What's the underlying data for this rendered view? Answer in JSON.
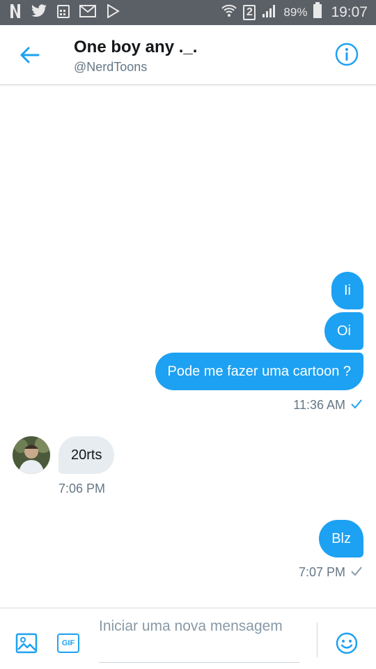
{
  "status_bar": {
    "icons": [
      "netflix-icon",
      "twitter-icon",
      "calendar-icon",
      "mail-icon",
      "play-store-icon",
      "wifi-icon",
      "sim-icon",
      "signal-icon",
      "battery-icon"
    ],
    "sim_label": "2",
    "battery": "89%",
    "time": "19:07"
  },
  "header": {
    "title": "One boy any ._.",
    "handle": "@NerdToons"
  },
  "colors": {
    "accent": "#1da1f2",
    "incoming": "#e6ecf0"
  },
  "messages": [
    {
      "direction": "out",
      "text": "Ii"
    },
    {
      "direction": "out",
      "text": "Oi"
    },
    {
      "direction": "out",
      "text": "Pode me fazer uma cartoon ?"
    },
    {
      "direction": "in",
      "text": "20rts"
    },
    {
      "direction": "out",
      "text": "Blz"
    }
  ],
  "timestamps": {
    "first_group": "11:36 AM",
    "incoming": "7:06 PM",
    "last": "7:07 PM"
  },
  "composer": {
    "placeholder": "Iniciar uma nova mensagem",
    "gif_label": "GIF"
  }
}
